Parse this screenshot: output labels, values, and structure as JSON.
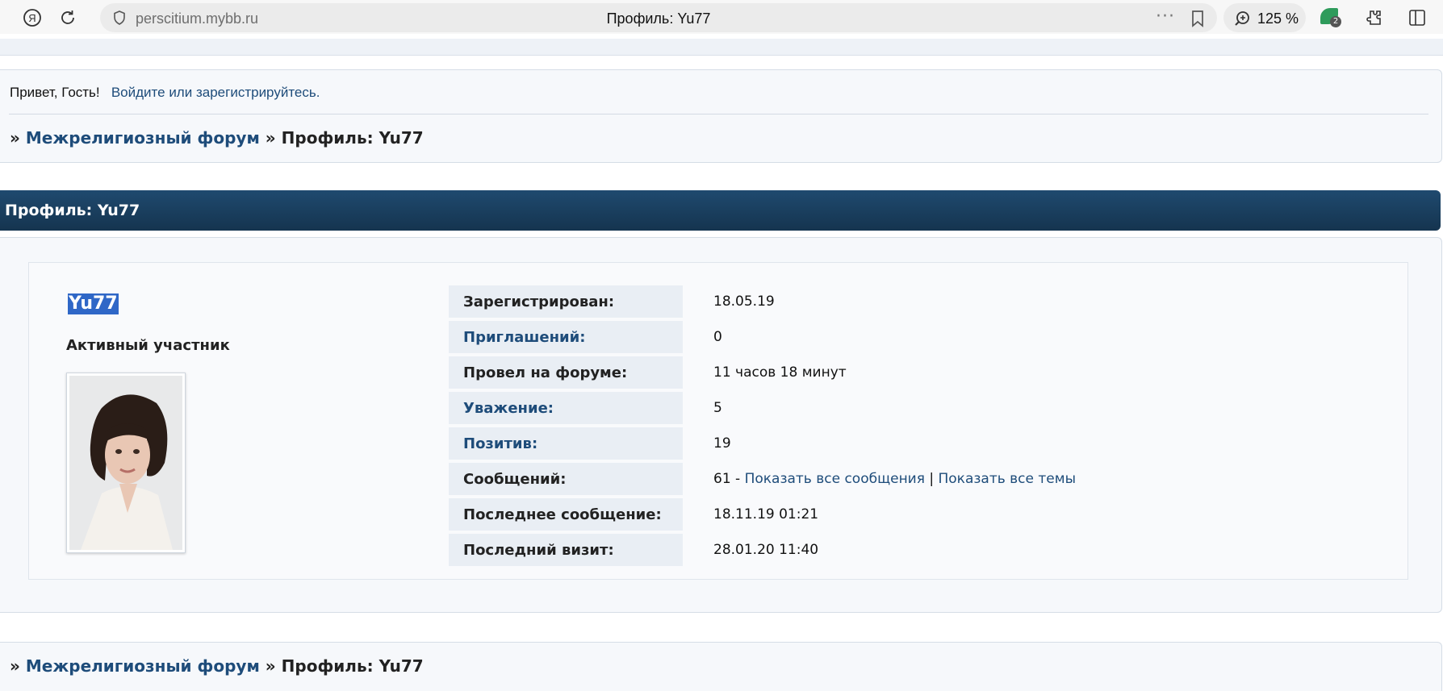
{
  "browser": {
    "url": "perscitium.mybb.ru",
    "tab_title": "Профиль: Yu77",
    "zoom": "125 %",
    "extension_count": "2"
  },
  "welcome": {
    "greeting": "Привет, Гость!",
    "login_link": "Войдите",
    "or_text": "или",
    "register_link": "зарегистрируйтесь."
  },
  "breadcrumb": {
    "separator": "»",
    "forum": "Межрелигиозный форум",
    "current": "Профиль: Yu77"
  },
  "header": {
    "title": "Профиль: Yu77"
  },
  "profile": {
    "username": "Yu77",
    "rank": "Активный участник",
    "fields": [
      {
        "label": "Зарегистрирован:",
        "value": "18.05.19"
      },
      {
        "label": "Приглашений:",
        "value": "0"
      },
      {
        "label": "Провел на форуме:",
        "value": "11 часов 18 минут"
      },
      {
        "label": "Уважение:",
        "value": "5"
      },
      {
        "label": "Позитив:",
        "value": "19"
      },
      {
        "label": "Сообщений:",
        "value": "61 -",
        "link_posts": "Показать все сообщения",
        "divider": "|",
        "link_topics": "Показать все темы"
      },
      {
        "label": "Последнее сообщение:",
        "value": "18.11.19 01:21"
      },
      {
        "label": "Последний визит:",
        "value": "28.01.20 11:40"
      }
    ]
  },
  "colors": {
    "link": "#1e4c7a",
    "header_bar": "#1c4466",
    "selection": "#2f67c7"
  }
}
